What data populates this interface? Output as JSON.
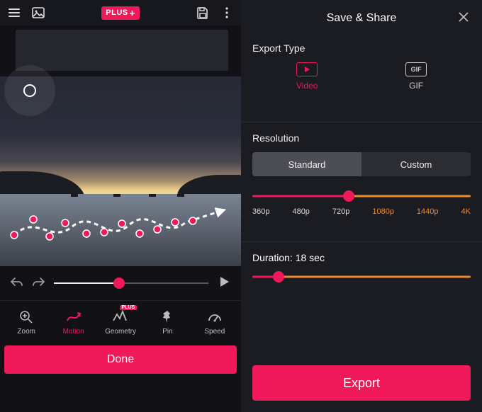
{
  "top": {
    "plus_badge": "PLUS",
    "plus_symbol": "+"
  },
  "playback": {
    "position_pct": 42
  },
  "toolbar": {
    "items": [
      {
        "label": "Zoom"
      },
      {
        "label": "Motion"
      },
      {
        "label": "Geometry",
        "plus": "PLUS"
      },
      {
        "label": "Pin"
      },
      {
        "label": "Speed"
      }
    ]
  },
  "done_label": "Done",
  "panel": {
    "title": "Save & Share",
    "export_type_label": "Export Type",
    "types": {
      "video": "Video",
      "gif": "GIF"
    },
    "resolution_label": "Resolution",
    "seg": {
      "standard": "Standard",
      "custom": "Custom"
    },
    "res_options": [
      "360p",
      "480p",
      "720p",
      "1080p",
      "1440p",
      "4K"
    ],
    "res_selected_index": 2,
    "duration_label": "Duration: 18 sec",
    "duration_value_sec": 18,
    "export_button": "Export"
  }
}
